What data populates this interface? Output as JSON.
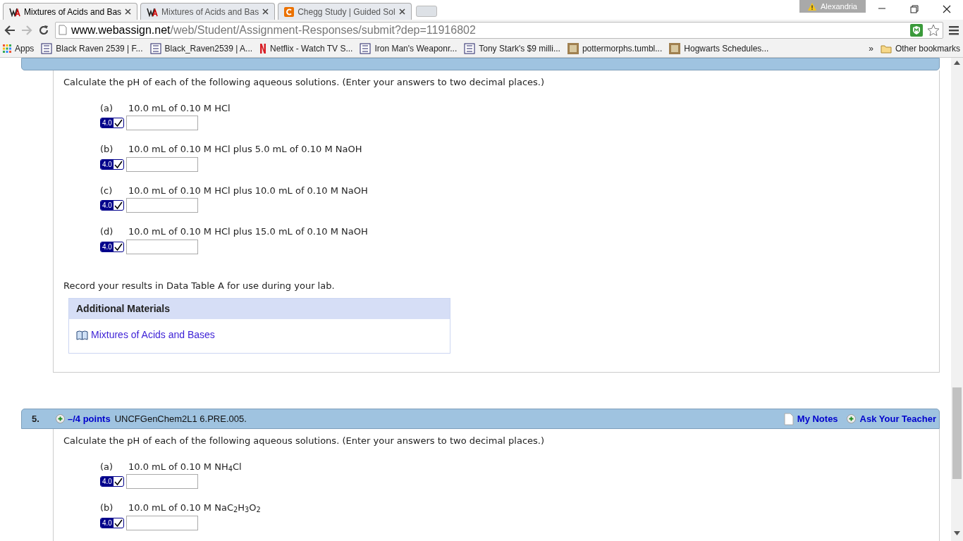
{
  "tabs": [
    {
      "title": "Mixtures of Acids and Bas",
      "kind": "wa",
      "selected": true
    },
    {
      "title": "Mixtures of Acids and Bas",
      "kind": "wa",
      "selected": false
    },
    {
      "title": "Chegg Study | Guided Sol",
      "kind": "chegg",
      "selected": false
    }
  ],
  "profile": {
    "name": "Alexandria"
  },
  "address_bar": {
    "domain": "www.webassign.net",
    "path": "/web/Student/Assignment-Responses/submit?dep=11916802"
  },
  "bookmarks": [
    {
      "label": "Apps",
      "kind": "apps"
    },
    {
      "label": "Black Raven 2539 | F...",
      "kind": "site"
    },
    {
      "label": "Black_Raven2539 | A...",
      "kind": "site"
    },
    {
      "label": "Netflix - Watch TV S...",
      "kind": "netflix"
    },
    {
      "label": "Iron Man's Weaponr...",
      "kind": "site"
    },
    {
      "label": "Tony Stark's $9 milli...",
      "kind": "site"
    },
    {
      "label": "pottermorphs.tumbl...",
      "kind": "photo"
    },
    {
      "label": "Hogwarts Schedules...",
      "kind": "photo"
    }
  ],
  "bookmarks_more": "»",
  "other_bookmarks": "Other bookmarks",
  "question_4": {
    "intro": "Calculate the pH of each of the following aqueous solutions. (Enter your answers to two decimal places.)",
    "parts": [
      {
        "label": "(a)",
        "text": "10.0 mL of 0.10 M HCl",
        "badge": "4.0"
      },
      {
        "label": "(b)",
        "text": "10.0 mL of 0.10 M HCl plus 5.0 mL of 0.10 M NaOH",
        "badge": "4.0"
      },
      {
        "label": "(c)",
        "text": "10.0 mL of 0.10 M HCl plus 10.0 mL of 0.10 M NaOH",
        "badge": "4.0"
      },
      {
        "label": "(d)",
        "text": "10.0 mL of 0.10 M HCl plus 15.0 mL of 0.10 M NaOH",
        "badge": "4.0"
      }
    ],
    "note": "Record your results in Data Table A for use during your lab.",
    "additional_materials": {
      "title": "Additional Materials",
      "link": "Mixtures of Acids and Bases"
    }
  },
  "question_5": {
    "number": "5.",
    "points": "–/4 points",
    "code": "UNCFGenChem2L1 6.PRE.005.",
    "my_notes": "My Notes",
    "ask_teacher": "Ask Your Teacher",
    "intro": "Calculate the pH of each of the following aqueous solutions. (Enter your answers to two decimal places.)",
    "parts": [
      {
        "label": "(a)",
        "text": "10.0 mL of 0.10 M NH$_{4}$Cl",
        "badge": "4.0"
      },
      {
        "label": "(b)",
        "text": "10.0 mL of 0.10 M NaC$_{2}$H$_{3}$O$_{2}$",
        "badge": "4.0"
      }
    ]
  }
}
